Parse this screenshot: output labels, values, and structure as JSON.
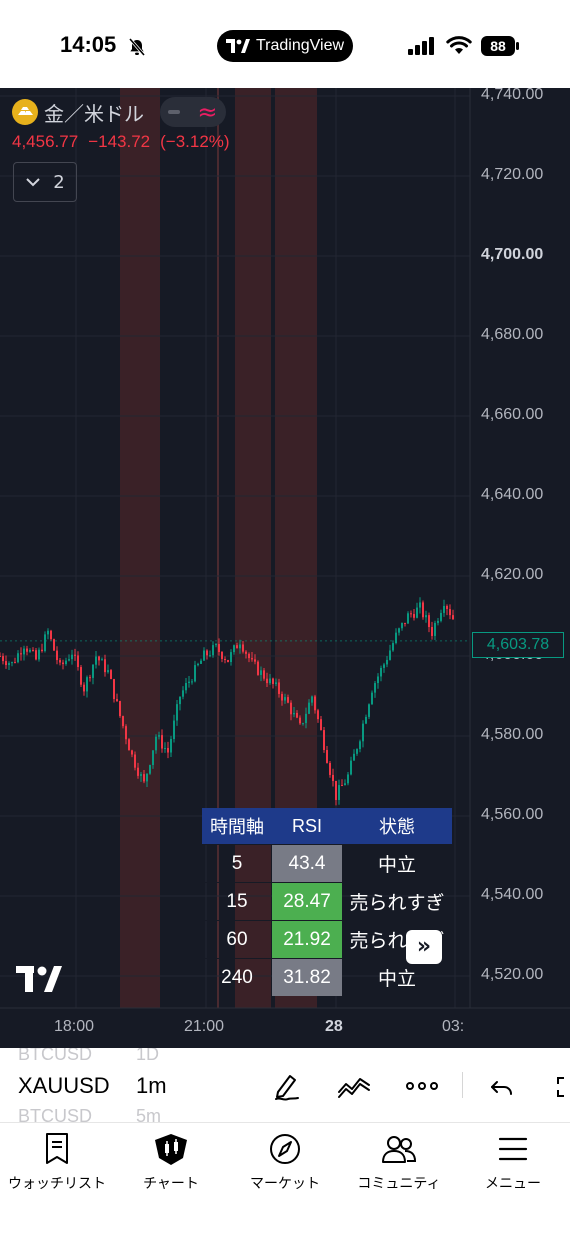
{
  "status_bar": {
    "time": "14:05",
    "app_pill": "TradingView",
    "battery": "88"
  },
  "chart": {
    "symbol_name": "金／米ドル",
    "price": "4,456.77",
    "change": "−143.72",
    "change_pct": "(−3.12%)",
    "indicator_count": "2",
    "y_axis_labels": [
      "4,740.00",
      "4,720.00",
      "4,700.00",
      "4,680.00",
      "4,660.00",
      "4,640.00",
      "4,620.00",
      "4,600.00",
      "4,580.00",
      "4,560.00",
      "4,540.00",
      "4,520.00"
    ],
    "y_axis_bold": "4,700.00",
    "last_price": "4,603.78",
    "x_axis_labels": [
      "18:00",
      "21:00",
      "28",
      "03:"
    ],
    "colors": {
      "background": "#161a25",
      "up": "#089981",
      "down": "#f23645",
      "highlight_band": "#3a2127"
    }
  },
  "chart_data": {
    "type": "line",
    "title": "金／米ドル",
    "xlabel": "",
    "ylabel": "",
    "ylim": [
      4510,
      4750
    ],
    "x": [
      0,
      3,
      6,
      9,
      12,
      15,
      18,
      21,
      24,
      27,
      30,
      33,
      36,
      39,
      42,
      45,
      48,
      51,
      54,
      57,
      60,
      63,
      66,
      69,
      72,
      75,
      78,
      81,
      84,
      87,
      90,
      93,
      96,
      99,
      102,
      105,
      108,
      111,
      114
    ],
    "values": [
      4600,
      4598,
      4603,
      4599,
      4606,
      4597,
      4601,
      4592,
      4600,
      4596,
      4585,
      4575,
      4568,
      4580,
      4576,
      4590,
      4595,
      4600,
      4602,
      4599,
      4604,
      4598,
      4595,
      4592,
      4588,
      4582,
      4590,
      4578,
      4565,
      4570,
      4580,
      4592,
      4598,
      4605,
      4610,
      4612,
      4606,
      4614,
      4608
    ],
    "x_tick_labels": [
      "18:00",
      "21:00",
      "28",
      "03:"
    ],
    "highlight_bands_count": 3
  },
  "rsi_table": {
    "headers": [
      "時間軸",
      "RSI",
      "状態"
    ],
    "rows": [
      {
        "tf": "5",
        "rsi": "43.4",
        "status": "中立",
        "color": "#787b86"
      },
      {
        "tf": "15",
        "rsi": "28.47",
        "status": "売られすぎ",
        "color": "#4caf50"
      },
      {
        "tf": "60",
        "rsi": "21.92",
        "status": "売られすぎ",
        "color": "#4caf50"
      },
      {
        "tf": "240",
        "rsi": "31.82",
        "status": "中立",
        "color": "#787b86"
      }
    ]
  },
  "symbol_bar": {
    "ghost_top_symbol": "BTCUSD",
    "ghost_top_interval": "1D",
    "symbol": "XAUUSD",
    "interval": "1m",
    "ghost_bottom_symbol": "BTCUSD",
    "ghost_bottom_interval": "5m"
  },
  "tab_bar": {
    "tabs": [
      {
        "label": "ウォッチリスト",
        "icon": "watchlist-icon"
      },
      {
        "label": "チャート",
        "icon": "chart-candles-icon"
      },
      {
        "label": "マーケット",
        "icon": "compass-icon"
      },
      {
        "label": "コミュニティ",
        "icon": "people-icon"
      },
      {
        "label": "メニュー",
        "icon": "hamburger-icon"
      }
    ]
  }
}
